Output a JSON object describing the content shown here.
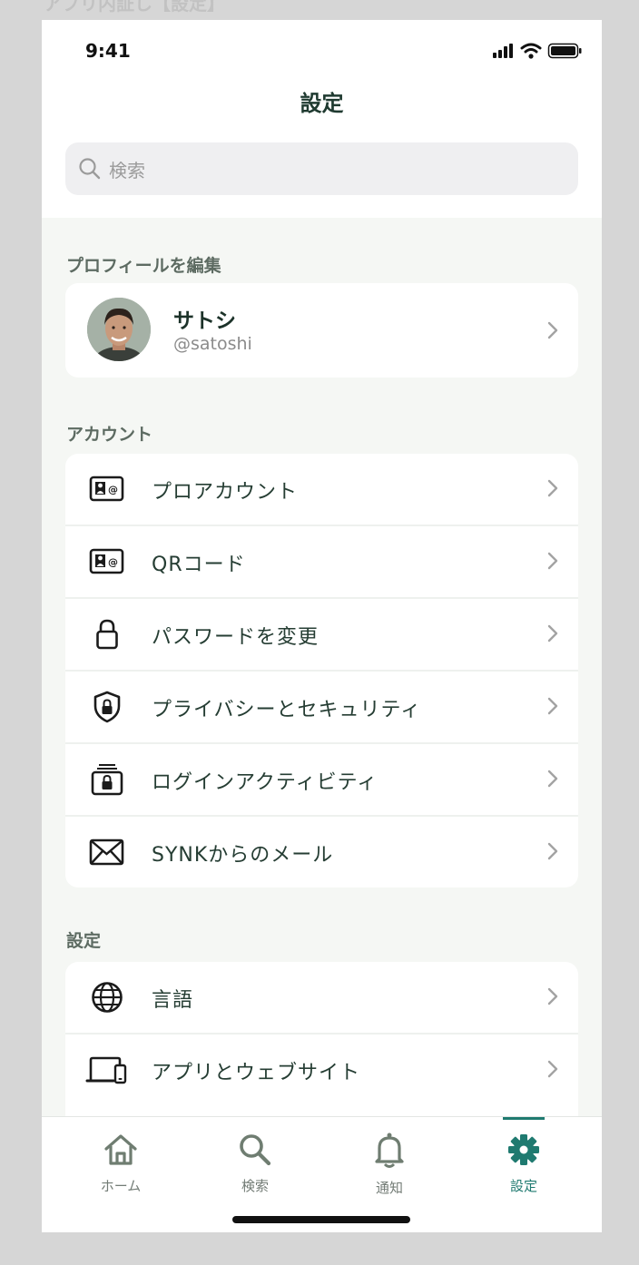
{
  "background_caption": "アプリ内証し【設定】",
  "status_bar": {
    "time": "9:41"
  },
  "header": {
    "title": "設定"
  },
  "search": {
    "placeholder": "検索"
  },
  "profile": {
    "section_title": "プロフィールを編集",
    "name": "サトシ",
    "handle": "@satoshi"
  },
  "account": {
    "section_title": "アカウント",
    "items": [
      {
        "label": "プロアカウント",
        "icon": "contact-card-icon"
      },
      {
        "label": "QRコード",
        "icon": "contact-card-icon"
      },
      {
        "label": "パスワードを変更",
        "icon": "lock-icon"
      },
      {
        "label": "プライバシーとセキュリティ",
        "icon": "shield-lock-icon"
      },
      {
        "label": "ログインアクティビティ",
        "icon": "login-activity-icon"
      },
      {
        "label": "SYNKからのメール",
        "icon": "mail-icon"
      }
    ]
  },
  "settings": {
    "section_title": "設定",
    "items": [
      {
        "label": "言語",
        "icon": "globe-icon"
      },
      {
        "label": "アプリとウェブサイト",
        "icon": "devices-icon"
      }
    ]
  },
  "tabbar": {
    "tabs": [
      {
        "label": "ホーム",
        "icon": "home-icon"
      },
      {
        "label": "検索",
        "icon": "search-icon"
      },
      {
        "label": "通知",
        "icon": "bell-icon"
      },
      {
        "label": "設定",
        "icon": "gear-icon",
        "active": true
      }
    ]
  },
  "colors": {
    "accent": "#1f7a70",
    "title_text": "#1f3a30",
    "page_background": "#f5f7f4"
  }
}
